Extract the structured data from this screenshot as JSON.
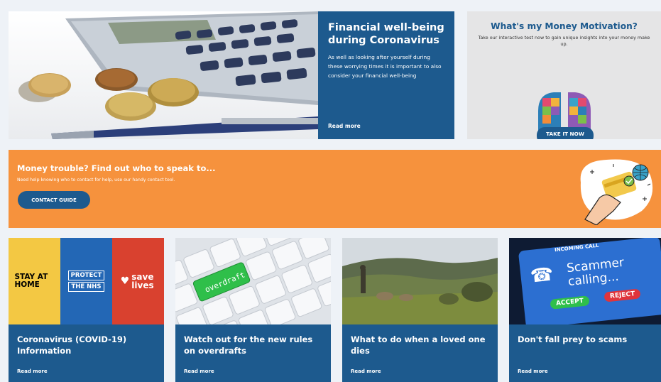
{
  "hero": {
    "title": "Financial well-being during Coronavirus",
    "description": "As well as looking after yourself during these worrying times it is important to also consider your financial well-being",
    "read_more": "Read more"
  },
  "motivation": {
    "title": "What's my Money Motivation?",
    "description": "Take our interactive test now to gain unique insights into your money make up.",
    "button": "TAKE IT NOW"
  },
  "banner": {
    "title": "Money trouble? Find out who to speak to...",
    "description": "Need help knowing who to contact for help, use our handy contact tool.",
    "button": "CONTACT GUIDE"
  },
  "cards": [
    {
      "title": "Coronavirus (COVID-19) Information",
      "read_more": "Read more",
      "image_text": {
        "stay": "STAY AT HOME",
        "protect_1": "PROTECT",
        "protect_2": "THE NHS",
        "save": "save lives"
      }
    },
    {
      "title": "Watch out for the new rules on overdrafts",
      "read_more": "Read more",
      "image_text": {
        "key": "overdraft"
      }
    },
    {
      "title": "What to do when a loved one dies",
      "read_more": "Read more"
    },
    {
      "title": "Don't fall prey to scams",
      "read_more": "Read more",
      "image_text": {
        "header": "INCOMING CALL",
        "caller_1": "Scammer",
        "caller_2": "calling...",
        "accept": "ACCEPT",
        "reject": "REJECT"
      }
    }
  ],
  "colors": {
    "navy": "#1d5a8e",
    "orange": "#f6923d",
    "grey_panel": "#e5e5e6",
    "background": "#eef2f7"
  }
}
